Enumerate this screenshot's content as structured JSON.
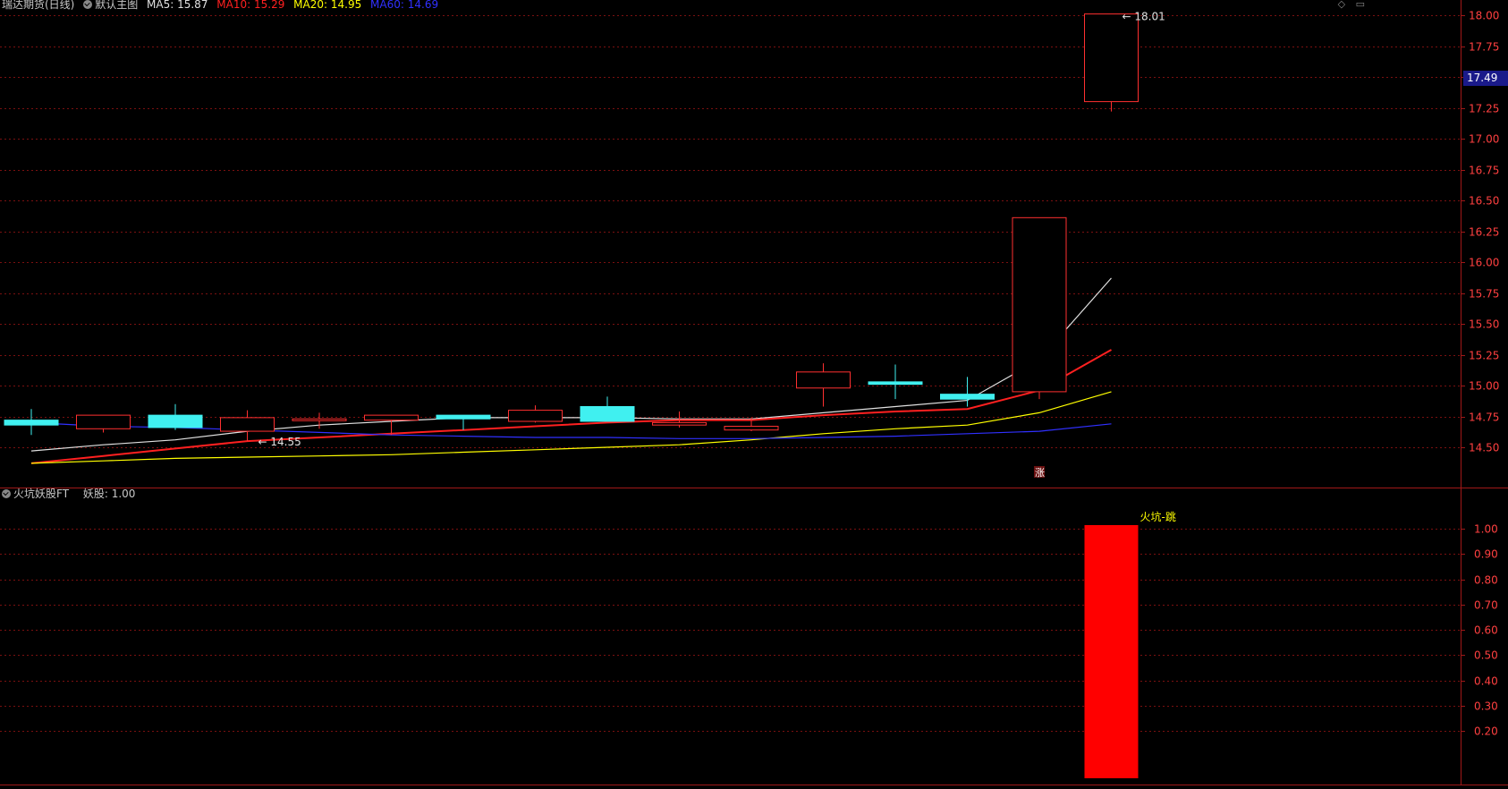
{
  "header": {
    "title": "瑞达期货(日线)",
    "template": "默认主图",
    "ma": [
      {
        "label": "MA5: 15.87",
        "color": "#e0e0e0"
      },
      {
        "label": "MA10: 15.29",
        "color": "#ff2020"
      },
      {
        "label": "MA20: 14.95",
        "color": "#ffff00"
      },
      {
        "label": "MA60: 14.69",
        "color": "#3030ff"
      }
    ]
  },
  "indicator_header": {
    "name": "火坑妖股FT",
    "value_label": "妖股: 1.00"
  },
  "current_price": "17.49",
  "colors": {
    "up": "#ff3030",
    "down": "#40f0f0",
    "grid": "#7a1010",
    "axis_text": "#ff4040",
    "signal": "#ff0000",
    "annotation": "#ffff00"
  },
  "chart_data": [
    {
      "type": "candlestick",
      "title": "瑞达期货(日线)",
      "ylim": [
        14.25,
        18.05
      ],
      "yticks": [
        "14.50",
        "14.75",
        "15.00",
        "15.25",
        "15.50",
        "15.75",
        "16.00",
        "16.25",
        "16.50",
        "16.75",
        "17.00",
        "17.25",
        "17.50",
        "17.75",
        "18.00"
      ],
      "candles": [
        {
          "open": 14.72,
          "close": 14.68,
          "high": 14.81,
          "low": 14.6
        },
        {
          "open": 14.65,
          "close": 14.76,
          "high": 14.76,
          "low": 14.62
        },
        {
          "open": 14.76,
          "close": 14.66,
          "high": 14.85,
          "low": 14.64
        },
        {
          "open": 14.63,
          "close": 14.74,
          "high": 14.8,
          "low": 14.55
        },
        {
          "open": 14.73,
          "close": 14.73,
          "high": 14.78,
          "low": 14.65
        },
        {
          "open": 14.72,
          "close": 14.76,
          "high": 14.76,
          "low": 14.6
        },
        {
          "open": 14.76,
          "close": 14.73,
          "high": 14.76,
          "low": 14.64
        },
        {
          "open": 14.71,
          "close": 14.8,
          "high": 14.84,
          "low": 14.7
        },
        {
          "open": 14.83,
          "close": 14.71,
          "high": 14.91,
          "low": 14.71
        },
        {
          "open": 14.68,
          "close": 14.7,
          "high": 14.79,
          "low": 14.66
        },
        {
          "open": 14.64,
          "close": 14.67,
          "high": 14.74,
          "low": 14.63
        },
        {
          "open": 14.98,
          "close": 15.11,
          "high": 15.18,
          "low": 14.83
        },
        {
          "open": 15.03,
          "close": 15.01,
          "high": 15.17,
          "low": 14.89
        },
        {
          "open": 14.93,
          "close": 14.89,
          "high": 15.07,
          "low": 14.83
        },
        {
          "open": 14.95,
          "close": 16.36,
          "high": 16.36,
          "low": 14.89
        },
        {
          "open": 17.3,
          "close": 18.01,
          "high": 18.01,
          "low": 17.22
        }
      ],
      "ma_lines": [
        {
          "name": "MA5",
          "color": "#e0e0e0",
          "values": [
            14.47,
            14.52,
            14.56,
            14.63,
            14.68,
            14.71,
            14.74,
            14.74,
            14.74,
            14.73,
            14.73,
            14.78,
            14.83,
            14.88,
            15.21,
            15.87
          ]
        },
        {
          "name": "MA10",
          "color": "#ff2020",
          "values": [
            14.37,
            14.43,
            14.49,
            14.55,
            14.58,
            14.61,
            14.64,
            14.67,
            14.7,
            14.72,
            14.72,
            14.76,
            14.79,
            14.81,
            14.96,
            15.29
          ]
        },
        {
          "name": "MA20",
          "color": "#ffff00",
          "values": [
            14.37,
            14.39,
            14.41,
            14.42,
            14.43,
            14.44,
            14.46,
            14.48,
            14.5,
            14.52,
            14.56,
            14.61,
            14.65,
            14.68,
            14.78,
            14.95
          ]
        },
        {
          "name": "MA60",
          "color": "#3030ff",
          "values": [
            14.7,
            14.67,
            14.66,
            14.64,
            14.62,
            14.6,
            14.59,
            14.58,
            14.58,
            14.57,
            14.57,
            14.58,
            14.59,
            14.61,
            14.63,
            14.69
          ]
        }
      ],
      "annotations": [
        {
          "text": "14.55",
          "candle": 3,
          "value": 14.55
        },
        {
          "text": "18.01",
          "candle": 15,
          "value": 18.01
        },
        {
          "text": "涨",
          "candle": 14,
          "value": 14.29
        }
      ]
    },
    {
      "type": "bar",
      "title": "火坑妖股FT",
      "ylim": [
        0,
        1.1
      ],
      "yticks": [
        "0.20",
        "0.30",
        "0.40",
        "0.50",
        "0.60",
        "0.70",
        "0.80",
        "0.90",
        "1.00"
      ],
      "values": [
        0,
        0,
        0,
        0,
        0,
        0,
        0,
        0,
        0,
        0,
        0,
        0,
        0,
        0,
        0,
        1.0
      ],
      "annotations": [
        {
          "text": "火坑-跳",
          "candle": 15
        }
      ]
    }
  ]
}
